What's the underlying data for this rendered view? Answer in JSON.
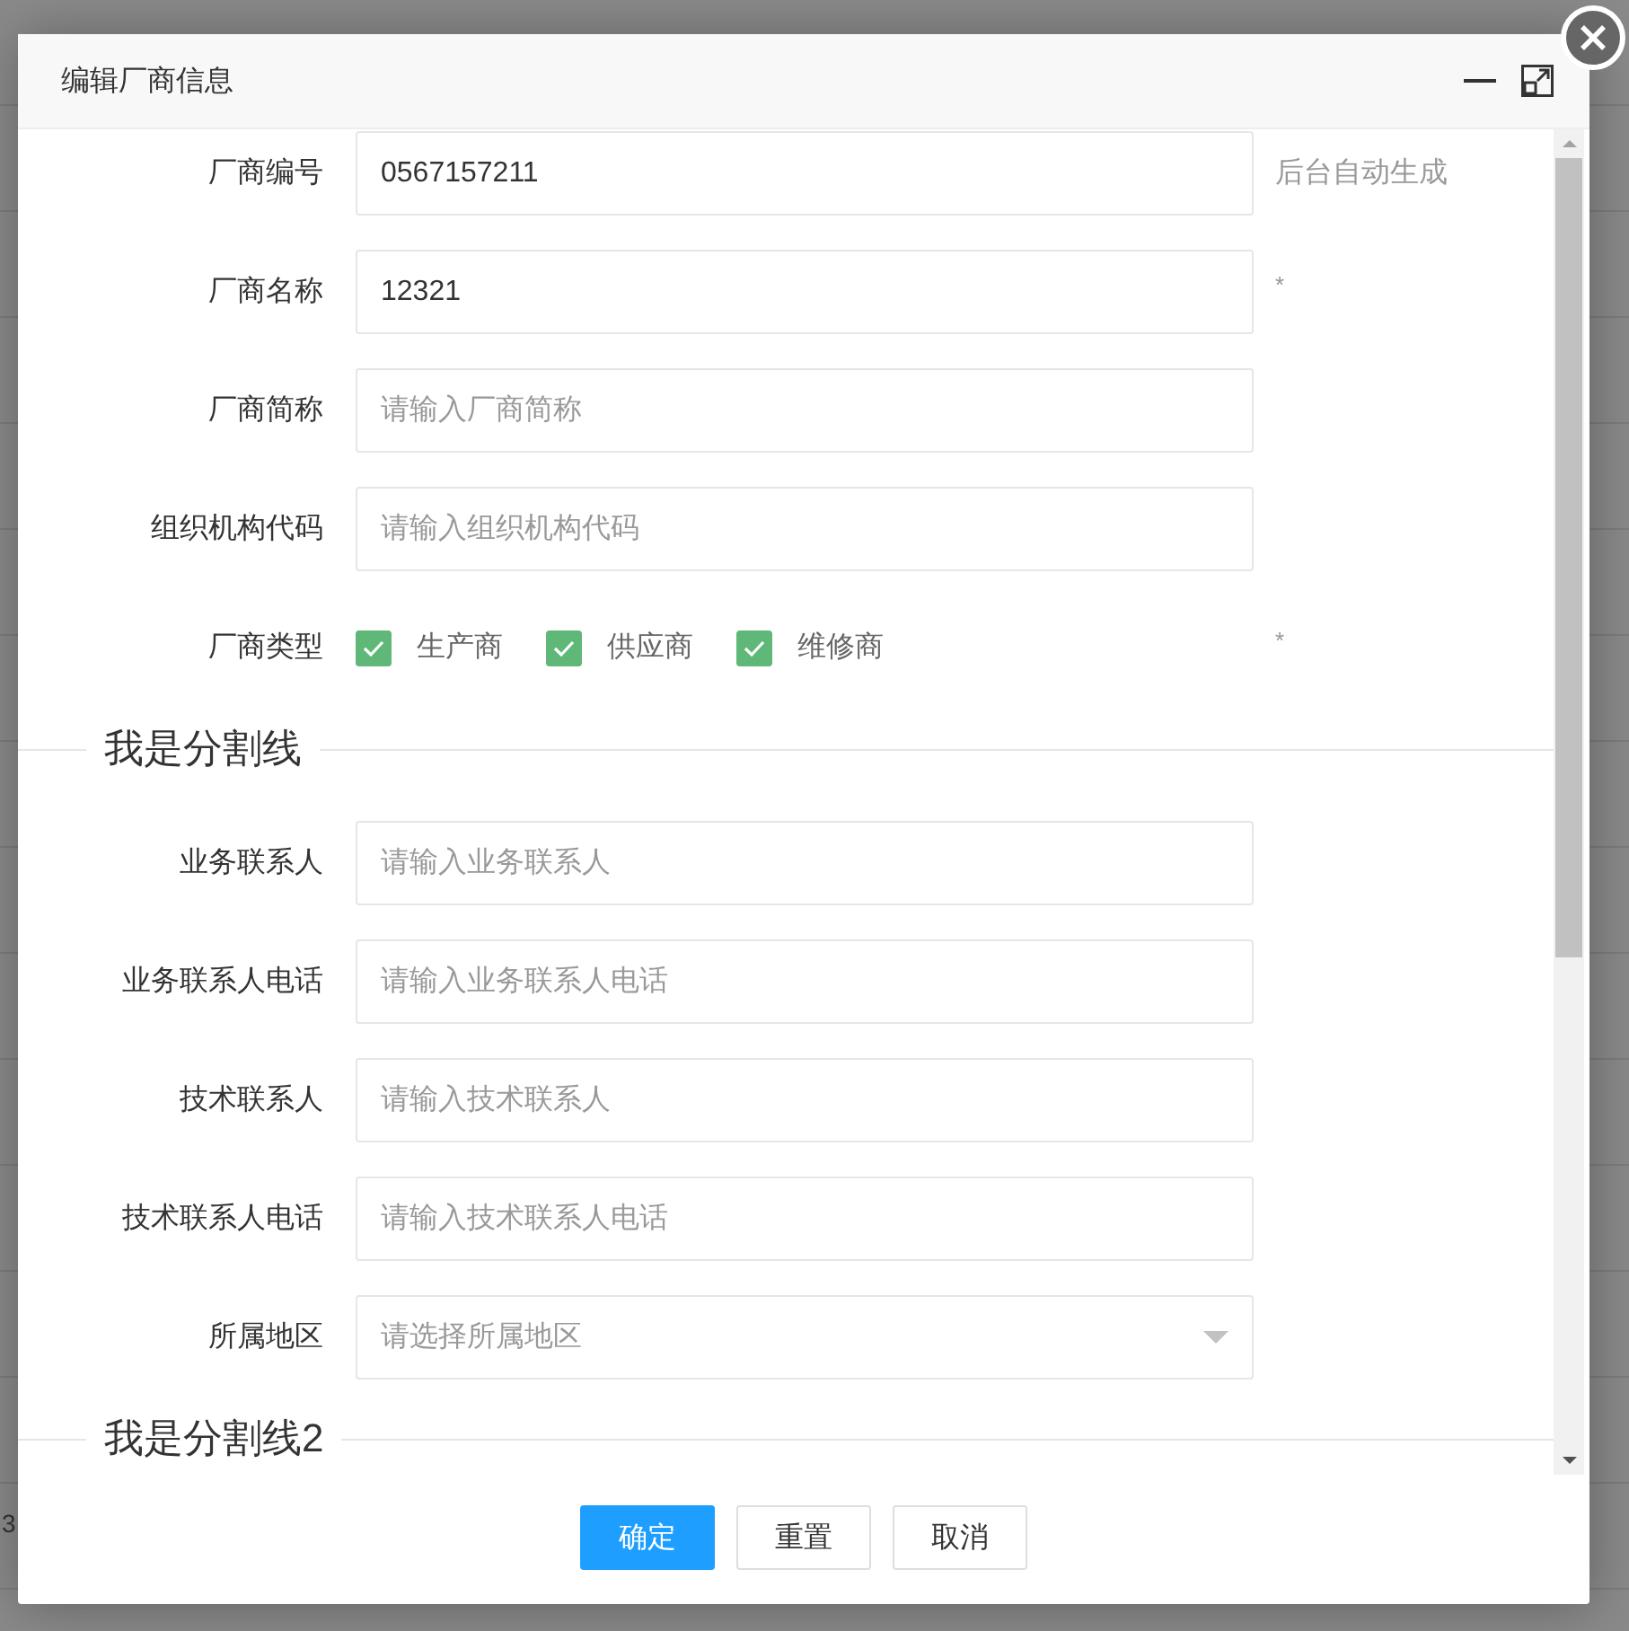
{
  "background": {
    "cell_text": "3"
  },
  "dialog": {
    "title": "编辑厂商信息",
    "sections": [
      {
        "fields": [
          {
            "kind": "input",
            "label": "厂商编号",
            "value": "0567157211",
            "hint": "后台自动生成"
          },
          {
            "kind": "input",
            "label": "厂商名称",
            "value": "12321",
            "hint": "*"
          },
          {
            "kind": "input",
            "label": "厂商简称",
            "placeholder": "请输入厂商简称"
          },
          {
            "kind": "input",
            "label": "组织机构代码",
            "placeholder": "请输入组织机构代码"
          },
          {
            "kind": "checkboxes",
            "label": "厂商类型",
            "hint": "*",
            "options": [
              {
                "label": "生产商",
                "checked": true
              },
              {
                "label": "供应商",
                "checked": true
              },
              {
                "label": "维修商",
                "checked": true
              }
            ]
          }
        ]
      },
      {
        "title": "我是分割线",
        "fields": [
          {
            "kind": "input",
            "label": "业务联系人",
            "placeholder": "请输入业务联系人"
          },
          {
            "kind": "input",
            "label": "业务联系人电话",
            "placeholder": "请输入业务联系人电话"
          },
          {
            "kind": "input",
            "label": "技术联系人",
            "placeholder": "请输入技术联系人"
          },
          {
            "kind": "input",
            "label": "技术联系人电话",
            "placeholder": "请输入技术联系人电话"
          },
          {
            "kind": "select",
            "label": "所属地区",
            "placeholder": "请选择所属地区"
          }
        ]
      },
      {
        "title": "我是分割线2"
      }
    ],
    "buttons": [
      {
        "label": "确定",
        "primary": true
      },
      {
        "label": "重置",
        "primary": false
      },
      {
        "label": "取消",
        "primary": false
      }
    ]
  }
}
